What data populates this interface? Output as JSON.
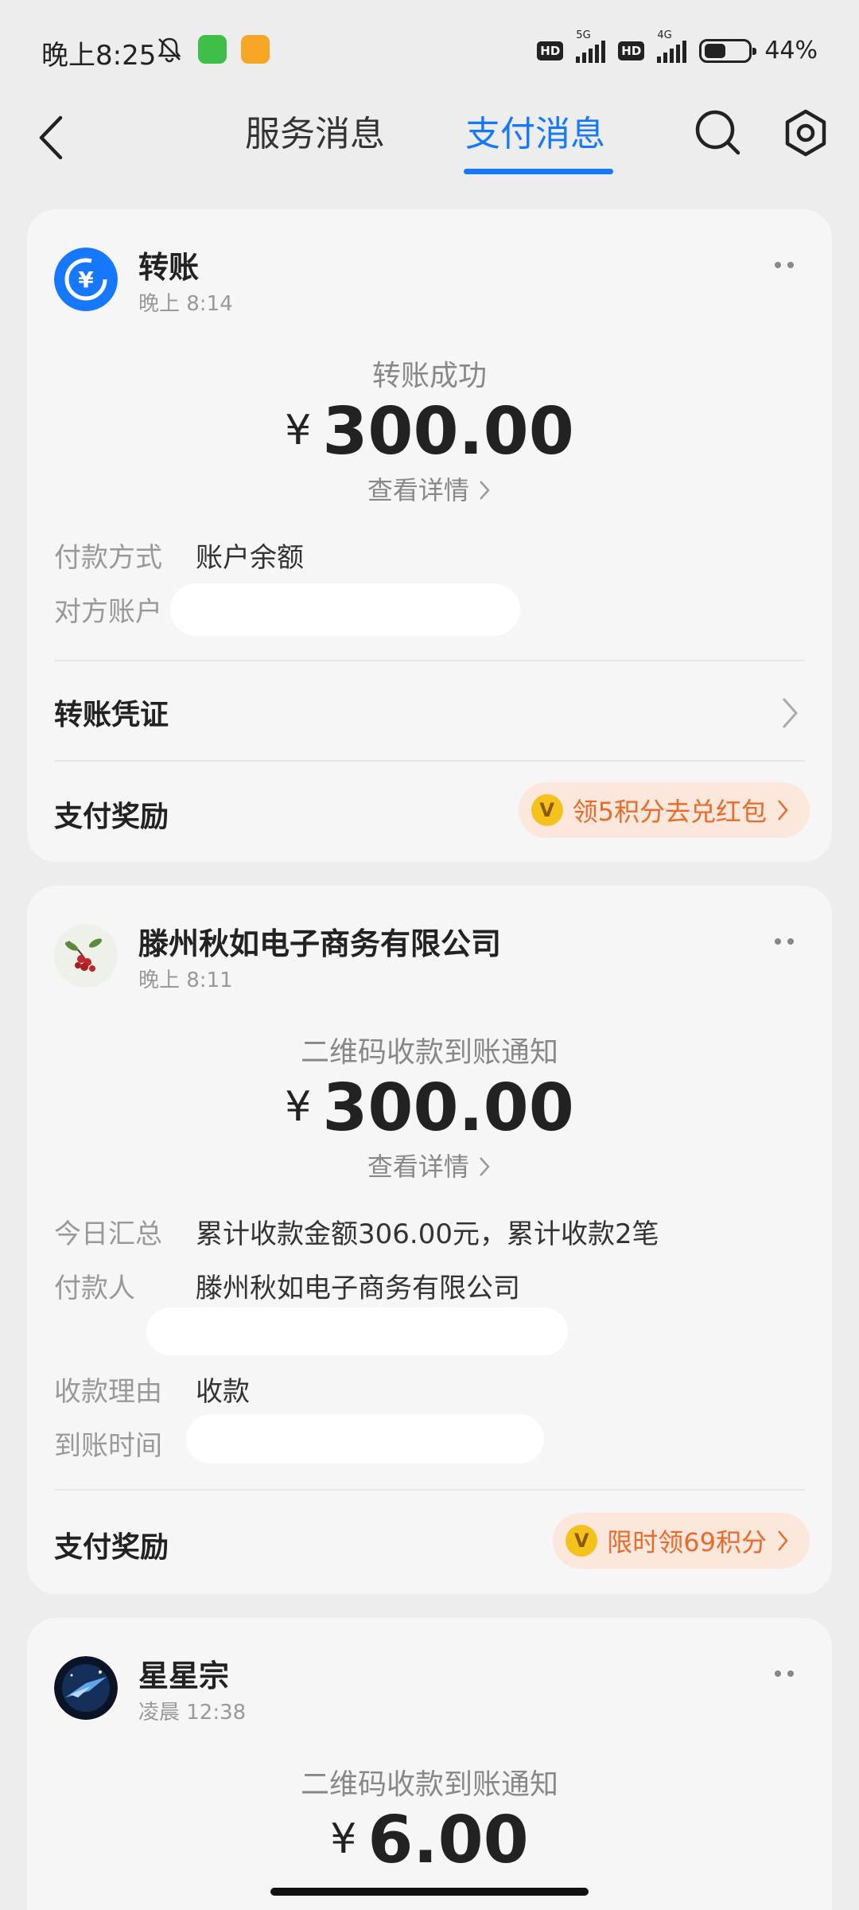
{
  "status_bar": {
    "time": "晚上8:25",
    "battery": "44%",
    "network_1": "5G",
    "network_2": "4G",
    "hd_label": "HD"
  },
  "header": {
    "tabs": [
      {
        "label": "服务消息",
        "active": false
      },
      {
        "label": "支付消息",
        "active": true
      }
    ],
    "accent_color": "#1677ff"
  },
  "cards": [
    {
      "title": "转账",
      "time": "晚上 8:14",
      "notice": "转账成功",
      "currency": "¥",
      "amount": "300.00",
      "detail_link": "查看详情",
      "rows": [
        {
          "key": "付款方式",
          "value": "账户余额"
        },
        {
          "key": "对方账户",
          "value": ""
        }
      ],
      "voucher_label": "转账凭证",
      "reward_label": "支付奖励",
      "reward_text": "领5积分去兑红包",
      "coin_symbol": "V"
    },
    {
      "title": "滕州秋如电子商务有限公司",
      "time": "晚上 8:11",
      "notice": "二维码收款到账通知",
      "currency": "¥",
      "amount": "300.00",
      "detail_link": "查看详情",
      "rows": [
        {
          "key": "今日汇总",
          "value": "累计收款金额306.00元，累计收款2笔"
        },
        {
          "key": "付款人",
          "value": "滕州秋如电子商务有限公司"
        },
        {
          "key": "收款理由",
          "value": "收款"
        },
        {
          "key": "到账时间",
          "value": ""
        }
      ],
      "reward_label": "支付奖励",
      "reward_text": "限时领69积分",
      "coin_symbol": "V"
    },
    {
      "title": "星星宗",
      "time": "凌晨 12:38",
      "notice": "二维码收款到账通知",
      "currency": "¥",
      "amount": "6.00"
    }
  ]
}
